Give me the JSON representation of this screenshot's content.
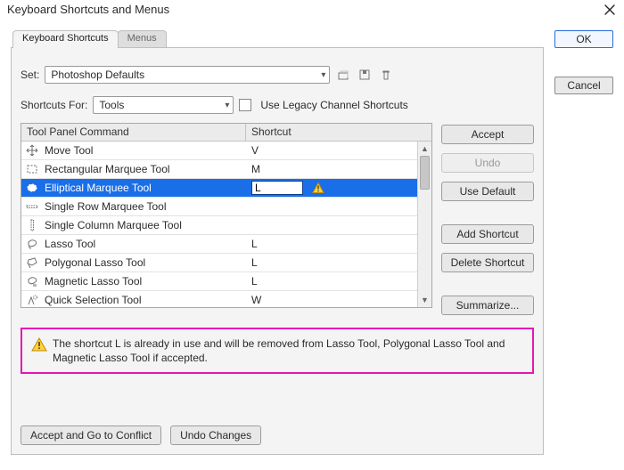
{
  "window": {
    "title": "Keyboard Shortcuts and Menus"
  },
  "right_buttons": {
    "ok": "OK",
    "cancel": "Cancel"
  },
  "tabs": {
    "shortcuts": "Keyboard Shortcuts",
    "menus": "Menus"
  },
  "set": {
    "label": "Set:",
    "value": "Photoshop Defaults"
  },
  "shortcuts_for": {
    "label": "Shortcuts For:",
    "value": "Tools"
  },
  "legacy_checkbox": "Use Legacy Channel Shortcuts",
  "table": {
    "header_cmd": "Tool Panel Command",
    "header_sc": "Shortcut",
    "rows": [
      {
        "name": "Move Tool",
        "shortcut": "V",
        "icon": "move"
      },
      {
        "name": "Rectangular Marquee Tool",
        "shortcut": "M",
        "icon": "rect-marquee"
      },
      {
        "name": "Elliptical Marquee Tool",
        "shortcut": "L",
        "icon": "ellipse-marquee",
        "selected": true,
        "editing": true,
        "conflict": true
      },
      {
        "name": "Single Row Marquee Tool",
        "shortcut": "",
        "icon": "row-marquee"
      },
      {
        "name": "Single Column Marquee Tool",
        "shortcut": "",
        "icon": "col-marquee"
      },
      {
        "name": "Lasso Tool",
        "shortcut": "L",
        "icon": "lasso"
      },
      {
        "name": "Polygonal Lasso Tool",
        "shortcut": "L",
        "icon": "poly-lasso"
      },
      {
        "name": "Magnetic Lasso Tool",
        "shortcut": "L",
        "icon": "mag-lasso"
      },
      {
        "name": "Quick Selection Tool",
        "shortcut": "W",
        "icon": "quick-select"
      }
    ]
  },
  "side": {
    "accept": "Accept",
    "undo": "Undo",
    "use_default": "Use Default",
    "add_shortcut": "Add Shortcut",
    "delete_shortcut": "Delete Shortcut",
    "summarize": "Summarize..."
  },
  "warning_msg": "The shortcut L is already in use and will be removed from Lasso Tool, Polygonal Lasso Tool and Magnetic Lasso Tool if accepted.",
  "bottom": {
    "accept_conflict": "Accept and Go to Conflict",
    "undo_changes": "Undo Changes"
  }
}
